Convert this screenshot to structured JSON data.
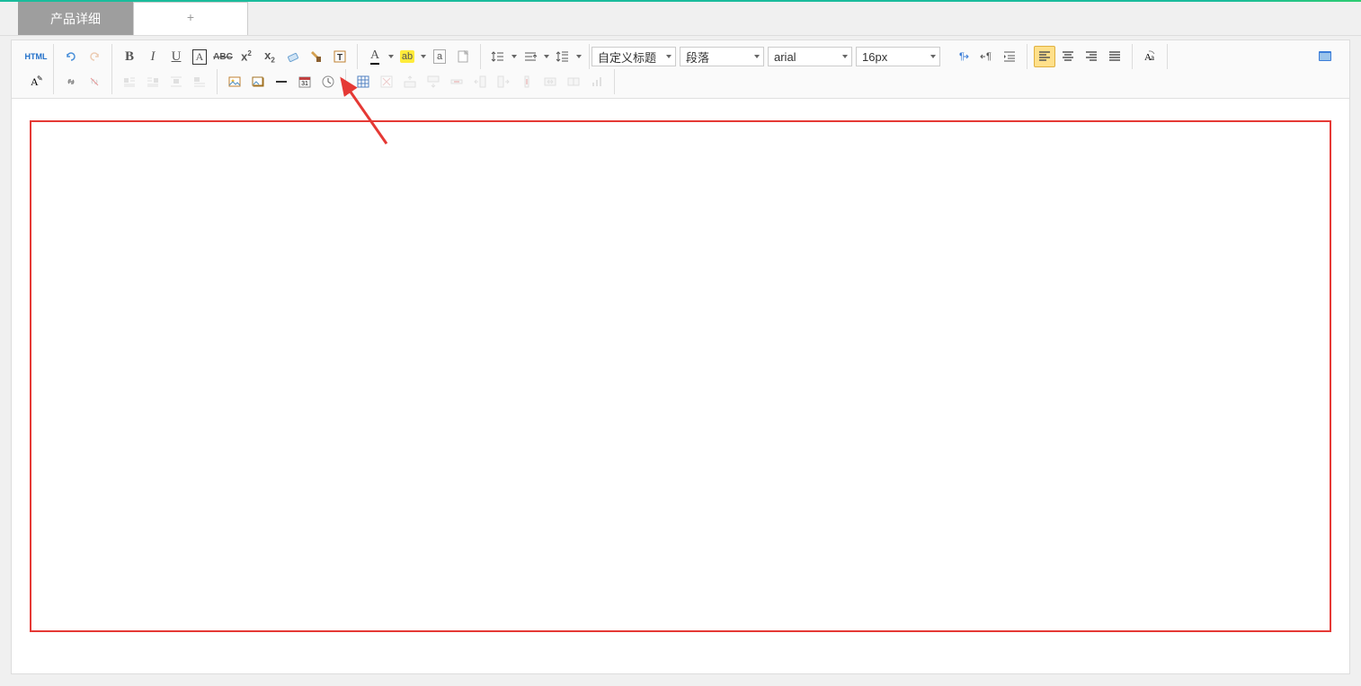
{
  "tabs": {
    "active_label": "产品详细",
    "add_label": "+"
  },
  "toolbar": {
    "html_label": "HTML",
    "select_custom_title": "自定义标题",
    "select_paragraph": "段落",
    "select_font": "arial",
    "select_size": "16px",
    "icons": {
      "undo": "undo-icon",
      "redo": "redo-icon",
      "bold": "B",
      "italic": "I",
      "underline": "U",
      "fontborder": "A",
      "strike": "ABC",
      "sup": "x²",
      "sub": "x₂",
      "eraser": "eraser-icon",
      "format_clear": "paintbrush-icon",
      "autotype": "T",
      "forecolor": "A",
      "backcolor": "ab",
      "case": "a",
      "blank": "blank-doc",
      "lineheight": "line-height",
      "indent": "indent",
      "rowspacing": "row-spacing",
      "dir_ltr": "¶→",
      "dir_rtl": "←¶",
      "outdent": "outdent-icon",
      "align_left": "align-left",
      "align_center": "align-center",
      "align_right": "align-right",
      "align_justify": "align-justify",
      "translate": "Aa",
      "fullscreen": "fullscreen-icon"
    },
    "row2": {
      "font_tool": "Aa",
      "link": "link-icon",
      "unlink": "unlink-icon",
      "img_left": "img-left",
      "img_right": "img-right",
      "img_center": "img-center",
      "img_none": "img-none",
      "insert_img": "image-icon",
      "insert_multi": "multi-image-icon",
      "hr": "hr-icon",
      "date": "date-icon",
      "time": "time-icon",
      "table": "table-icon",
      "del_table": "del-table",
      "ins_row_before": "row-before",
      "ins_row_after": "row-after",
      "del_row": "del-row",
      "ins_col_before": "col-before",
      "ins_col_after": "col-after",
      "del_col": "del-col",
      "merge": "merge-cells",
      "split": "split-cells",
      "chart": "chart-icon"
    }
  }
}
